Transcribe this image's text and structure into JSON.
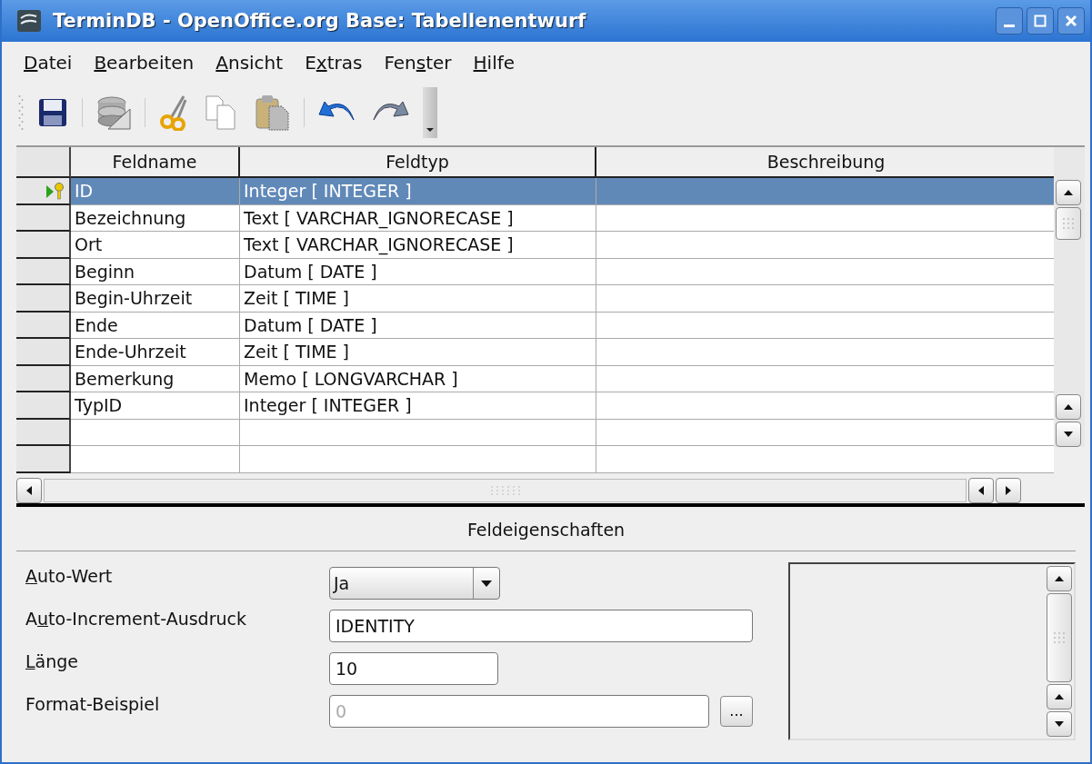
{
  "window": {
    "title": "TerminDB - OpenOffice.org Base: Tabellenentwurf"
  },
  "menu": [
    {
      "key": "D",
      "after": "atei"
    },
    {
      "key": "B",
      "after": "earbeiten"
    },
    {
      "key": "A",
      "after": "nsicht"
    },
    {
      "before": "E",
      "key": "x",
      "after": "tras"
    },
    {
      "before": "Fen",
      "key": "s",
      "after": "ter"
    },
    {
      "key": "H",
      "after": "ilfe"
    }
  ],
  "table": {
    "columns": [
      "Feldname",
      "Feldtyp",
      "Beschreibung"
    ],
    "rows": [
      {
        "name": "ID",
        "type": "Integer [ INTEGER ]",
        "selected": true,
        "primary_key": true
      },
      {
        "name": "Bezeichnung",
        "type": "Text [ VARCHAR_IGNORECASE ]",
        "selected": false,
        "primary_key": false
      },
      {
        "name": "Ort",
        "type": "Text [ VARCHAR_IGNORECASE ]",
        "selected": false,
        "primary_key": false
      },
      {
        "name": "Beginn",
        "type": "Datum [ DATE ]",
        "selected": false,
        "primary_key": false
      },
      {
        "name": "Begin-Uhrzeit",
        "type": "Zeit [ TIME ]",
        "selected": false,
        "primary_key": false
      },
      {
        "name": "Ende",
        "type": "Datum [ DATE ]",
        "selected": false,
        "primary_key": false
      },
      {
        "name": "Ende-Uhrzeit",
        "type": "Zeit [ TIME ]",
        "selected": false,
        "primary_key": false
      },
      {
        "name": "Bemerkung",
        "type": "Memo [ LONGVARCHAR ]",
        "selected": false,
        "primary_key": false
      },
      {
        "name": "TypID",
        "type": "Integer [ INTEGER ]",
        "selected": false,
        "primary_key": false
      }
    ]
  },
  "properties": {
    "title": "Feldeigenschaften",
    "fields": [
      {
        "kind": "dropdown",
        "label": {
          "key": "A",
          "after": "uto-Wert"
        },
        "value": "Ja",
        "disabled": false
      },
      {
        "kind": "text",
        "label": {
          "before": "A",
          "key": "u",
          "after": "to-Increment-Ausdruck"
        },
        "value": "IDENTITY",
        "disabled": false
      },
      {
        "kind": "short",
        "label": {
          "key": "L",
          "after": "änge"
        },
        "value": "10",
        "disabled": false
      },
      {
        "kind": "button",
        "label": {
          "before": "Format-Beispiel"
        },
        "value": "0",
        "disabled": true,
        "button": "..."
      }
    ]
  }
}
